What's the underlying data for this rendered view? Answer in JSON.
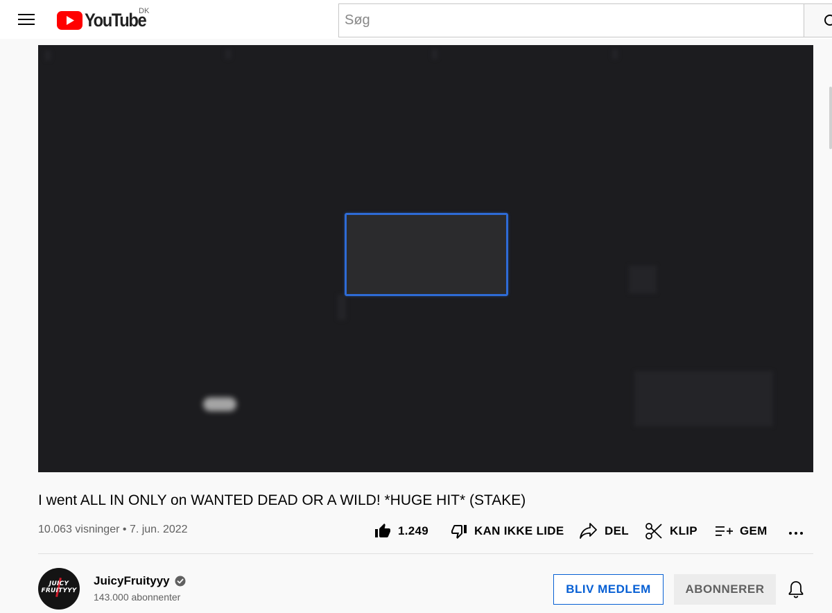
{
  "header": {
    "logo_text": "YouTube",
    "country_code": "DK",
    "search_placeholder": "Søg",
    "brand_red": "#ff0000"
  },
  "video": {
    "title": "I went ALL IN ONLY on WANTED DEAD OR A WILD! *HUGE HIT* (STAKE)",
    "views": "10.063 visninger",
    "separator": "•",
    "date": "7. jun. 2022"
  },
  "actions": {
    "like_count": "1.249",
    "dislike_label": "KAN IKKE LIDE",
    "share_label": "DEL",
    "clip_label": "KLIP",
    "save_label": "GEM",
    "more_label": "..."
  },
  "channel": {
    "name": "JuicyFruityyy",
    "subscribers": "143.000 abonnenter",
    "avatar_text_top": "JUICY",
    "avatar_text_bottom": "FRUITYYY",
    "verified": true
  },
  "buttons": {
    "join_label": "BLIV MEDLEM",
    "subscribed_label": "ABONNERER"
  },
  "colors": {
    "accent_blue": "#065fd4",
    "player_bg": "#1c1c1f",
    "player_box_border": "#2e6bd6"
  },
  "icons": [
    "hamburger-menu-icon",
    "youtube-logo-icon",
    "search-icon",
    "thumbs-up-icon",
    "thumbs-down-icon",
    "share-icon",
    "scissors-icon",
    "playlist-add-icon",
    "more-icon",
    "verified-icon",
    "bell-icon"
  ]
}
